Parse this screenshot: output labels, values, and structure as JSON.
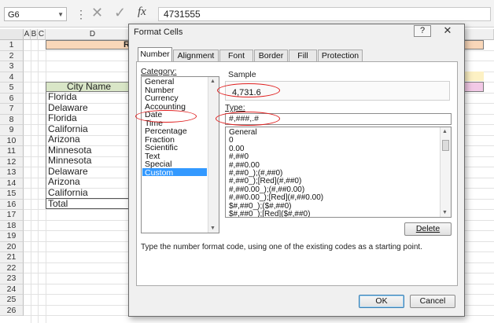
{
  "formula_bar": {
    "name_box": "G6",
    "separator": "⋮",
    "cancel_glyph": "✕",
    "enter_glyph": "✓",
    "fx_label": "fx",
    "value": "4731555"
  },
  "grid": {
    "column_headers": [
      "A",
      "B",
      "C",
      "D"
    ],
    "row_numbers": [
      "1",
      "2",
      "3",
      "4",
      "5",
      "6",
      "7",
      "8",
      "9",
      "10",
      "11",
      "12",
      "13",
      "14",
      "15",
      "16",
      "17",
      "18",
      "19",
      "20",
      "21",
      "22",
      "23",
      "24",
      "25",
      "26"
    ],
    "title_cell": "R",
    "table_header": "City Name",
    "cities": [
      "Florida",
      "Delaware",
      "Florida",
      "California",
      "Arizona",
      "Minnesota",
      "Minnesota",
      "Delaware",
      "Arizona",
      "California"
    ],
    "total_label": "Total"
  },
  "dialog": {
    "title": "Format Cells",
    "help_label": "?",
    "close_label": "✕",
    "tabs": [
      "Number",
      "Alignment",
      "Font",
      "Border",
      "Fill",
      "Protection"
    ],
    "active_tab": "Number",
    "category_label": "Category:",
    "categories": [
      "General",
      "Number",
      "Currency",
      "Accounting",
      "Date",
      "Time",
      "Percentage",
      "Fraction",
      "Scientific",
      "Text",
      "Special",
      "Custom"
    ],
    "selected_category": "Custom",
    "sample_label": "Sample",
    "sample_value": "4,731.6",
    "type_label": "Type:",
    "type_value": "#,###,.#",
    "format_codes": [
      "General",
      "0",
      "0.00",
      "#,##0",
      "#,##0.00",
      "#,##0_);(#,##0)",
      "#,##0_);[Red](#,##0)",
      "#,##0.00_);(#,##0.00)",
      "#,##0.00_);[Red](#,##0.00)",
      "$#,##0_);($#,##0)",
      "$#,##0_);[Red]($#,##0)"
    ],
    "delete_label": "Delete",
    "hint": "Type the number format code, using one of the existing codes as a starting point.",
    "ok_label": "OK",
    "cancel_label": "Cancel"
  },
  "colors": {
    "highlight": "#3399ff",
    "annotation": "#e02020",
    "title_fill": "#f9d7b9",
    "header_fill": "#d9e6c7"
  }
}
